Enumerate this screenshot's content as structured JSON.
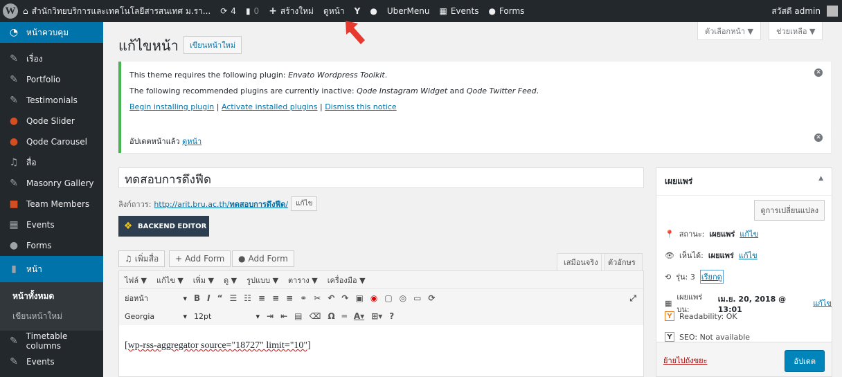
{
  "adminbar": {
    "site_name": "สำนักวิทยบริการและเทคโนโลยีสารสนเทศ ม.รา...",
    "updates_count": "4",
    "comments_count": "0",
    "new_label": "สร้างใหม่",
    "view_label": "ดูหน้า",
    "ubermenu_label": "UberMenu",
    "events_label": "Events",
    "forms_label": "Forms",
    "greeting": "สวัสดี admin"
  },
  "sidebar": {
    "items": [
      {
        "label": "หน้าควบคุม",
        "icon": "dashboard-icon"
      },
      {
        "label": "เรื่อง",
        "icon": "pin-icon"
      },
      {
        "label": "Portfolio",
        "icon": "pin-icon"
      },
      {
        "label": "Testimonials",
        "icon": "pin-icon"
      },
      {
        "label": "Qode Slider",
        "icon": "circle-icon"
      },
      {
        "label": "Qode Carousel",
        "icon": "circle-icon"
      },
      {
        "label": "สื่อ",
        "icon": "media-icon"
      },
      {
        "label": "Masonry Gallery",
        "icon": "pin-icon"
      },
      {
        "label": "Team Members",
        "icon": "team-icon"
      },
      {
        "label": "Events",
        "icon": "calendar-icon"
      },
      {
        "label": "Forms",
        "icon": "forms-icon"
      },
      {
        "label": "หน้า",
        "icon": "page-icon"
      },
      {
        "label": "Timetable columns",
        "icon": "pin-icon"
      },
      {
        "label": "Events",
        "icon": "pin-icon"
      }
    ],
    "submenu": [
      "หน้าทั้งหมด",
      "เขียนหน้าใหม่"
    ]
  },
  "header": {
    "screen_options": "ตัวเลือกหน้า ▼",
    "help": "ช่วยเหลือ ▼",
    "title": "แก้ไขหน้า",
    "add_new": "เขียนหน้าใหม่"
  },
  "notice1": {
    "line1_prefix": "This theme requires the following plugin: ",
    "line1_plugin": "Envato Wordpress Toolkit",
    "line1_suffix": ".",
    "line2_prefix": "The following recommended plugins are currently inactive: ",
    "line2_plugin1": "Qode Instagram Widget",
    "line2_and": " and ",
    "line2_plugin2": "Qode Twitter Feed",
    "line2_suffix": ".",
    "link_begin": "Begin installing plugin",
    "link_activate": "Activate installed plugins",
    "link_dismiss": "Dismiss this notice",
    "separator": " | "
  },
  "notice2": {
    "text": "อัปเดตหน้าแล้ว ",
    "link": "ดูหน้า"
  },
  "post": {
    "title": "ทดสอบการดึงฟีด",
    "permalink_label": "ลิงก์ถาวร:",
    "permalink_base": "http://arit.bru.ac.th/",
    "permalink_slug": "ทดสอบการดึงฟีด",
    "permalink_end": "/",
    "edit_slug": "แก้ไข",
    "backend_editor": "BACKEND EDITOR"
  },
  "editor": {
    "add_media": "เพิ่มสื่อ",
    "add_form1": "Add Form",
    "add_form2": "Add Form",
    "tab_visual": "เสมือนจริง",
    "tab_text": "ตัวอักษร",
    "menus": [
      "ไฟล์ ▼",
      "แก้ไข ▼",
      "เพิ่ม ▼",
      "ดู ▼",
      "รูปแบบ ▼",
      "ตาราง ▼",
      "เครื่องมือ ▼"
    ],
    "format_select": "ย่อหน้า",
    "font_select": "Georgia",
    "size_select": "12pt",
    "content": "[wp-rss-aggregator source=\"18727\" limit=\"10\"]"
  },
  "publish": {
    "title": "เผยแพร่",
    "preview": "ดูการเปลี่ยนแปลง",
    "status_label": "สถานะ: ",
    "status_value": "เผยแพร่",
    "visibility_label": "เห็นได้: ",
    "visibility_value": "เผยแพร่",
    "revisions_label": "รุ่น: 3 ",
    "revisions_link": "เรียกดู",
    "published_label": "เผยแพร่บน: ",
    "published_value": "เม.ย. 20, 2018 @ 13:01",
    "edit": "แก้ไข",
    "readability": "Readability: OK",
    "seo": "SEO: Not available",
    "trash": "ย้ายไปถังขยะ",
    "update": "อัปเดต"
  }
}
